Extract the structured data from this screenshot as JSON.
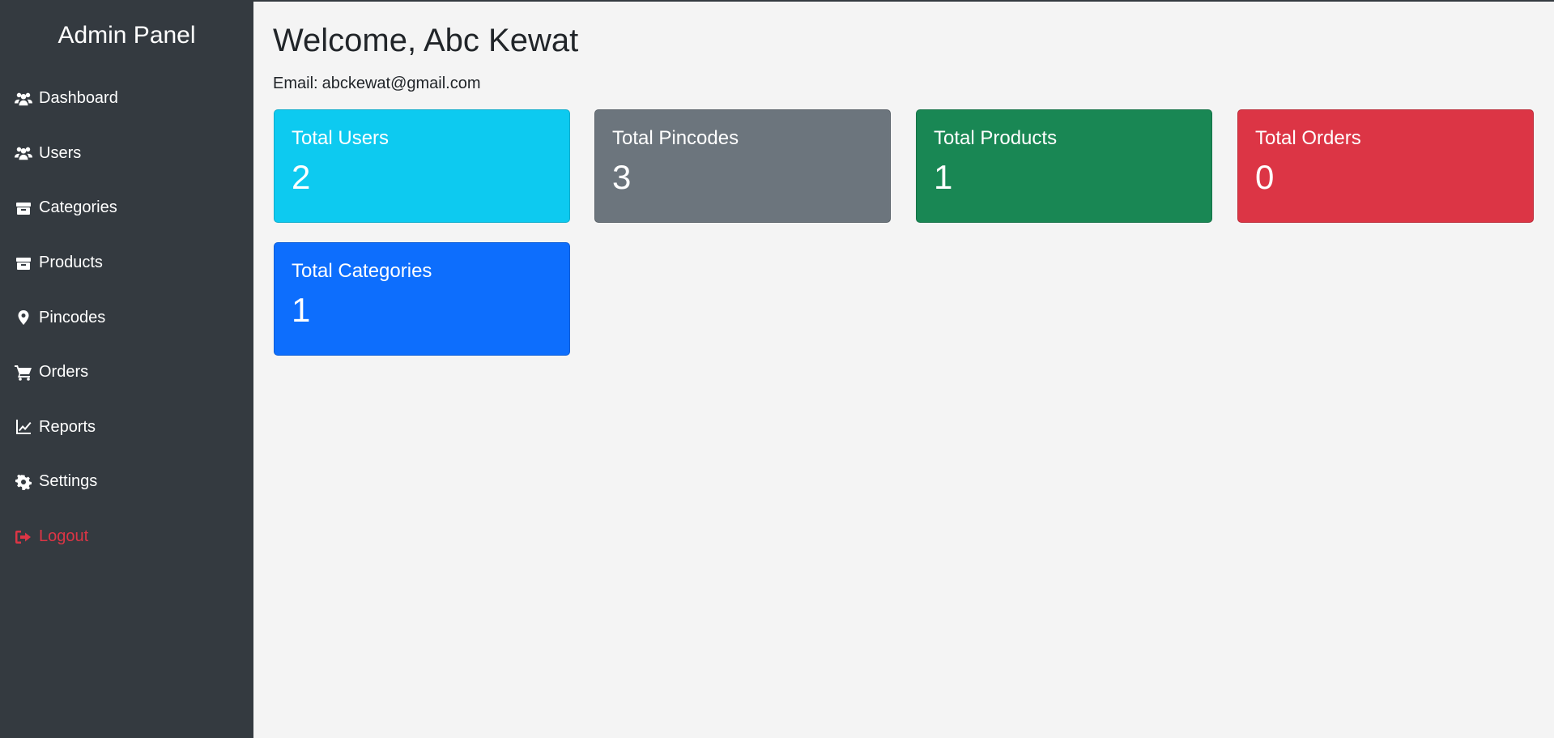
{
  "sidebar": {
    "title": "Admin Panel",
    "items": [
      {
        "label": "Dashboard",
        "icon": "users-icon"
      },
      {
        "label": "Users",
        "icon": "users-icon"
      },
      {
        "label": "Categories",
        "icon": "box-icon"
      },
      {
        "label": "Products",
        "icon": "box-icon"
      },
      {
        "label": "Pincodes",
        "icon": "map-marker-icon"
      },
      {
        "label": "Orders",
        "icon": "cart-icon"
      },
      {
        "label": "Reports",
        "icon": "chart-line-icon"
      },
      {
        "label": "Settings",
        "icon": "gear-icon"
      },
      {
        "label": "Logout",
        "icon": "sign-out-icon"
      }
    ]
  },
  "main": {
    "welcome": "Welcome, Abc Kewat",
    "email_label": "Email:",
    "email_value": "abckewat@gmail.com"
  },
  "cards": [
    {
      "label": "Total Users",
      "value": "2",
      "color": "#0dcaf0"
    },
    {
      "label": "Total Pincodes",
      "value": "3",
      "color": "#6c757d"
    },
    {
      "label": "Total Products",
      "value": "1",
      "color": "#198754"
    },
    {
      "label": "Total Orders",
      "value": "0",
      "color": "#dc3545"
    },
    {
      "label": "Total Categories",
      "value": "1",
      "color": "#0d6efd"
    }
  ],
  "colors": {
    "sidebar_bg": "#343a40",
    "page_bg": "#f4f4f4",
    "logout": "#dc3545"
  }
}
